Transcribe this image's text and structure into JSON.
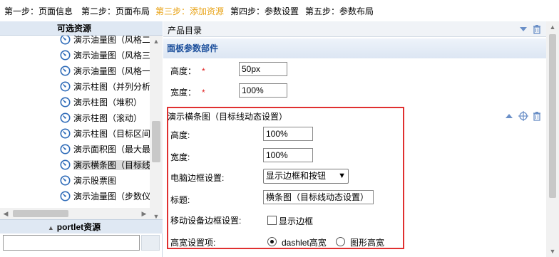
{
  "steps": [
    {
      "label": "第一步：页面信息"
    },
    {
      "label": "第二步：页面布局"
    },
    {
      "label": "第三步：添加资源",
      "active": true
    },
    {
      "label": "第四步：参数设置"
    },
    {
      "label": "第五步：参数布局"
    }
  ],
  "left_panel": {
    "title": "可选资源",
    "items": [
      "演示油量图（风格二）",
      "演示油量图（风格三）",
      "演示油量图（风格一）",
      "演示柱图（并列分析）",
      "演示柱图（堆积）",
      "演示柱图（滚动）",
      "演示柱图（目标区间）",
      "演示面积图（最大最小）",
      "演示横条图（目标线动态设置）",
      "演示股票图",
      "演示油量图（步数仪表）"
    ],
    "selected_index": 8,
    "portlet_title": "portlet资源",
    "portlet_search_value": ""
  },
  "main": {
    "catalog_title": "产品目录",
    "panel_title": "面板参数部件",
    "height_label": "高度：",
    "height_value": "50px",
    "width_label": "宽度：",
    "width_value": "100%",
    "required_mark": "*",
    "component": {
      "title": "演示横条图（目标线动态设置）",
      "height_label": "高度:",
      "height_value": "100%",
      "width_label": "宽度:",
      "width_value": "100%",
      "border_label": "电脑边框设置:",
      "border_value": "显示边框和按钮",
      "title_label": "标题:",
      "title_value": "横条图（目标线动态设置）",
      "mobile_border_label": "移动设备边框设置:",
      "mobile_border_option": "显示边框",
      "mobile_border_checked": false,
      "size_label": "高宽设置项:",
      "size_option_1": "dashlet高宽",
      "size_option_2": "图形高宽",
      "size_selected": 1
    }
  },
  "colors": {
    "active_step": "#e8a317",
    "panel_title": "#1c4f9c",
    "highlight_border": "#e03030",
    "required": "#e02020"
  }
}
